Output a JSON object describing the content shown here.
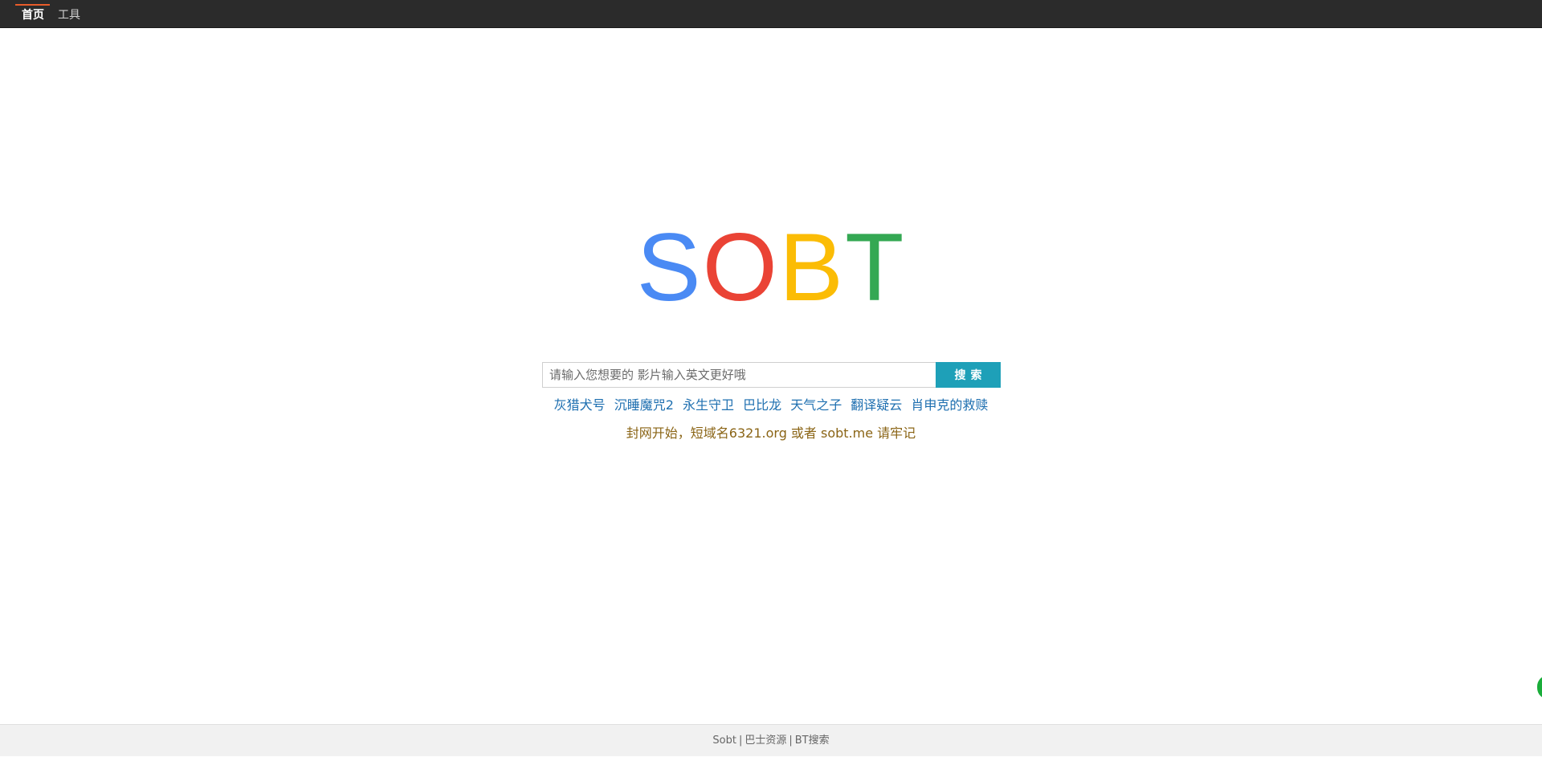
{
  "nav": {
    "items": [
      {
        "label": "首页",
        "active": true
      },
      {
        "label": "工具",
        "active": false
      }
    ]
  },
  "logo": {
    "letters": [
      {
        "char": "S",
        "color": "#4a8af4"
      },
      {
        "char": "O",
        "color": "#ea4335"
      },
      {
        "char": "B",
        "color": "#fbbc05"
      },
      {
        "char": "T",
        "color": "#34a853"
      }
    ]
  },
  "search": {
    "placeholder": "请输入您想要的 影片输入英文更好哦",
    "value": "",
    "button_label": "搜索"
  },
  "hot_keywords": [
    "灰猎犬号",
    "沉睡魔咒2",
    "永生守卫",
    "巴比龙",
    "天气之子",
    "翻译疑云",
    "肖申克的救赎"
  ],
  "notice": "封网开始，短域名6321.org 或者 sobt.me 请牢记",
  "footer": {
    "links": [
      "Sobt",
      "巴士资源",
      "BT搜索"
    ],
    "separator": "|"
  },
  "colors": {
    "topbar": "#2b2b2b",
    "accent": "#e85b2a",
    "search_button": "#1ea0b8",
    "link": "#1e6fb0",
    "notice": "#8a6415"
  }
}
